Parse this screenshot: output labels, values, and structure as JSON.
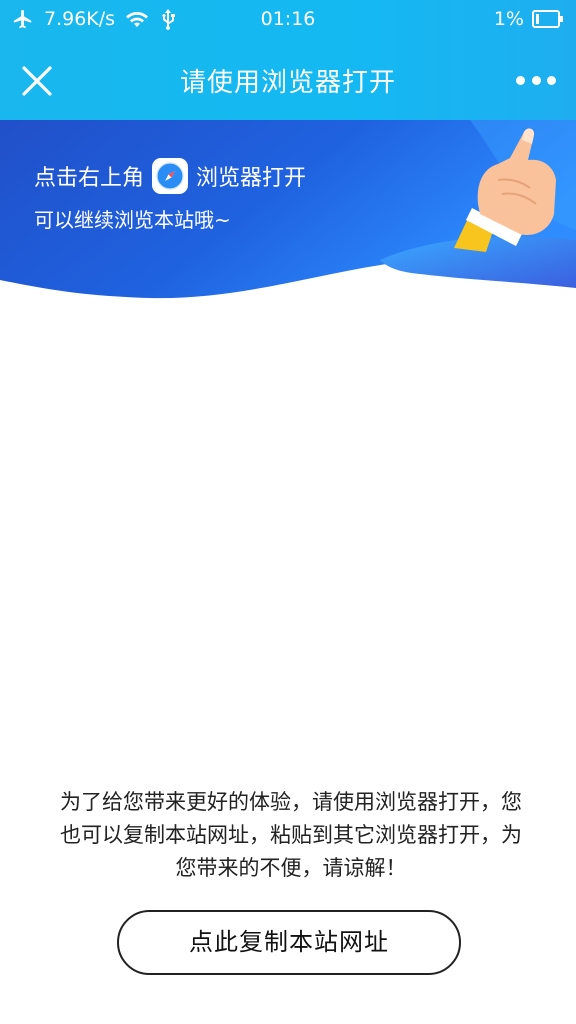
{
  "status_bar": {
    "net_speed": "7.96K/s",
    "time": "01:16",
    "battery": "1%",
    "icons": [
      "airplane-icon",
      "wifi-icon",
      "usb-icon",
      "battery-icon"
    ]
  },
  "nav": {
    "title": "请使用浏览器打开",
    "close_icon": "close-icon",
    "more_icon": "more-icon"
  },
  "banner": {
    "line1_before": "点击右上角",
    "line1_after": "浏览器打开",
    "line2": "可以继续浏览本站哦~",
    "icon": "compass-icon"
  },
  "notice": {
    "text": "为了给您带来更好的体验，请使用浏览器打开，您也可以复制本站网址，粘贴到其它浏览器打开，为您带来的不便，请谅解！"
  },
  "copy_button": {
    "label": "点此复制本站网址"
  },
  "colors": {
    "header": "#16b8f1",
    "banner_dark": "#1e4fc8",
    "banner_light": "#2a86ff"
  }
}
